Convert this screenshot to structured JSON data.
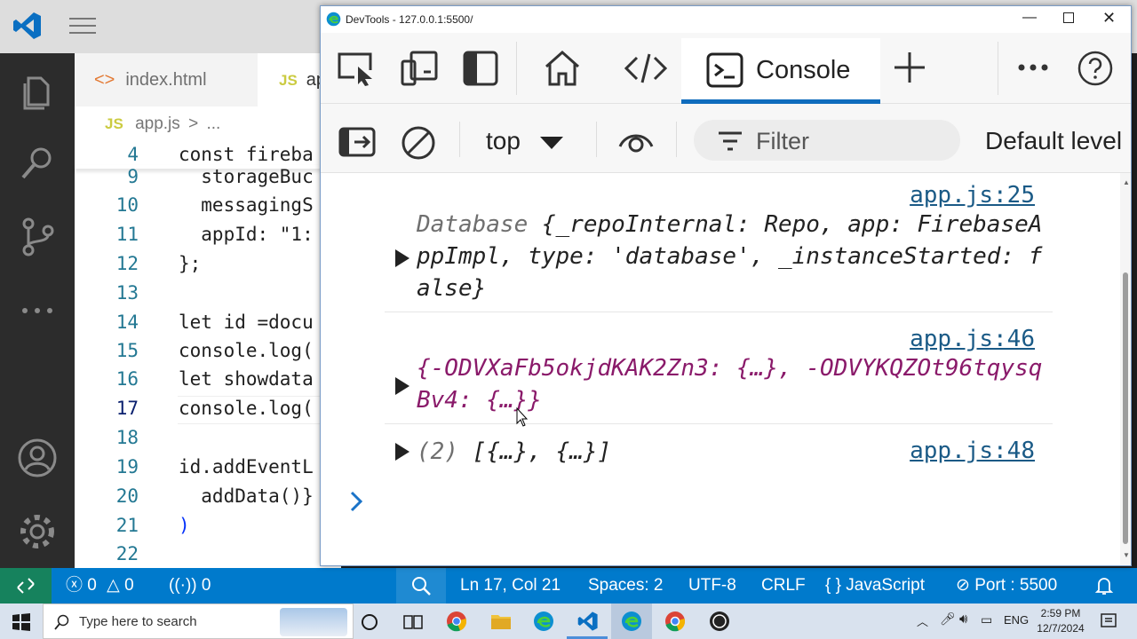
{
  "vscode": {
    "tabs": [
      {
        "icon": "<>",
        "label": "index.html"
      },
      {
        "icon": "JS",
        "label": "ap"
      }
    ],
    "breadcrumb": {
      "icon": "JS",
      "file": "app.js",
      "sep": ">",
      "rest": "..."
    },
    "lines": [
      {
        "n": "4",
        "code": "const fireba"
      },
      {
        "n": "9",
        "code": "  storageBuc"
      },
      {
        "n": "10",
        "code": "  messagingS"
      },
      {
        "n": "11",
        "code": "  appId: \"1:"
      },
      {
        "n": "12",
        "code": "};"
      },
      {
        "n": "13",
        "code": ""
      },
      {
        "n": "14",
        "code": "let id =docu"
      },
      {
        "n": "15",
        "code": "console.log("
      },
      {
        "n": "16",
        "code": "let showdata"
      },
      {
        "n": "17",
        "code": "console.log("
      },
      {
        "n": "18",
        "code": ""
      },
      {
        "n": "19",
        "code": "id.addEventL"
      },
      {
        "n": "20",
        "code": "  addData()}"
      },
      {
        "n": "21",
        "code": ")"
      },
      {
        "n": "22",
        "code": ""
      }
    ],
    "status": {
      "errors": "0",
      "warnings": "0",
      "ports": "0",
      "position": "Ln 17, Col 21",
      "spaces": "Spaces: 2",
      "encoding": "UTF-8",
      "eol": "CRLF",
      "language": "JavaScript",
      "port": "Port : 5500"
    }
  },
  "devtools": {
    "title": "DevTools - 127.0.0.1:5500/",
    "active_tab": "Console",
    "context": "top",
    "filter_placeholder": "Filter",
    "levels": "Default level",
    "messages": [
      {
        "source": "app.js:25",
        "prefix": "Database ",
        "body": "{_repoInternal: Repo, app: FirebaseAppImpl, type: 'database', _instanceStarted: false}"
      },
      {
        "source": "app.js:46",
        "prefix": "",
        "body": "{-ODVXaFb5okjdKAK2Zn3: {…}, -ODVYKQZOt96tqysqBv4: {…}}"
      },
      {
        "source": "app.js:48",
        "prefix": "(2) ",
        "body": "[{…}, {…}]"
      }
    ]
  },
  "taskbar": {
    "search_placeholder": "Type here to search",
    "time": "2:59 PM",
    "date": "12/7/2024",
    "lang": "ENG"
  }
}
